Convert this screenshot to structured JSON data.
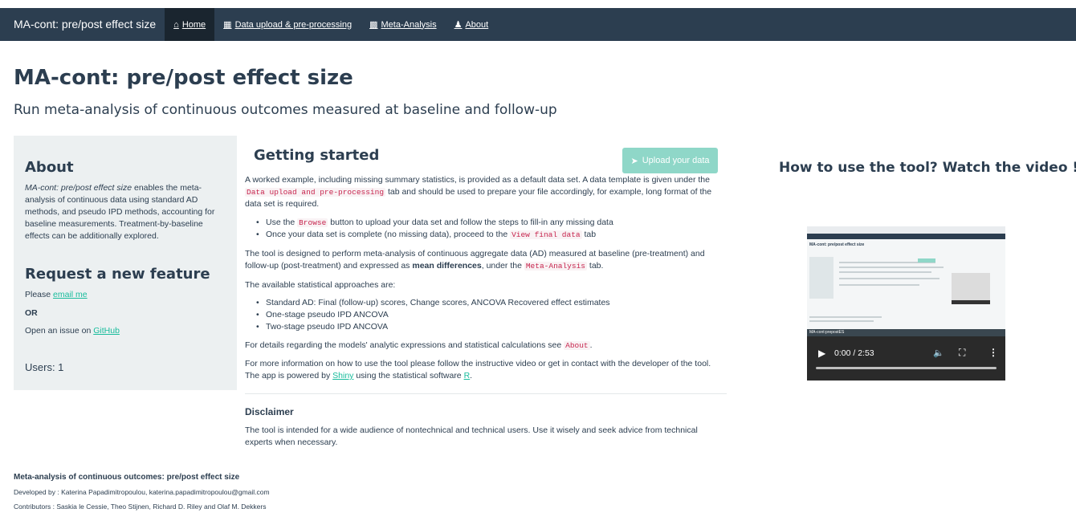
{
  "navbar": {
    "brand": "MA-cont: pre/post effect size",
    "items": [
      {
        "label": "Home",
        "icon": "home-icon",
        "active": true
      },
      {
        "label": "Data upload & pre-processing",
        "icon": "table-icon",
        "active": false
      },
      {
        "label": "Meta-Analysis",
        "icon": "bar-chart-icon",
        "active": false
      },
      {
        "label": "About",
        "icon": "users-icon",
        "active": false
      }
    ]
  },
  "header": {
    "title": "MA-cont: pre/post effect size",
    "subtitle": "Run meta-analysis of continuous outcomes measured at baseline and follow-up"
  },
  "sidebar": {
    "about_heading": "About",
    "about_italic": "MA-cont: pre/post effect size",
    "about_text": " enables the meta-analysis of continuous data using standard AD methods, and pseudo IPD methods, accounting for baseline measurements. Treatment-by-baseline effects can be additionally explored.",
    "request_heading": "Request a new feature",
    "please_text": "Please ",
    "email_link": "email me",
    "or_text": "OR",
    "issue_text": "Open an issue on ",
    "github_link": "GitHub",
    "users": "Users: 1"
  },
  "main": {
    "title": "Getting started",
    "upload_button": "Upload your data",
    "p1_a": "A worked example, including missing summary statistics, is provided as a default data set. A data template is given under the ",
    "p1_code": "Data upload and pre-processing",
    "p1_b": " tab and should be used to prepare your file accordingly, for example, long format of the data set is required.",
    "li1_a": "Use the ",
    "li1_code": "Browse",
    "li1_b": " button to upload your data set and follow the steps to fill-in any missing data",
    "li2_a": "Once your data set is complete (no missing data), proceed to the ",
    "li2_code": "View final data",
    "li2_b": " tab",
    "p2_a": "The tool is designed to perform meta-analysis of continuous aggregate data (AD) measured at baseline (pre-treatment) and follow-up (post-treatment) and expressed as ",
    "p2_bold": "mean differences",
    "p2_b": ", under the ",
    "p2_code": "Meta-Analysis",
    "p2_c": " tab.",
    "p3": "The available statistical approaches are:",
    "approaches": [
      "Standard AD: Final (follow-up) scores, Change scores, ANCOVA Recovered effect estimates",
      "One-stage pseudo IPD ANCOVA",
      "Two-stage pseudo IPD ANCOVA"
    ],
    "p4_a": "For details regarding the models' analytic expressions and statistical calculations see ",
    "p4_code": "About",
    "p4_b": ".",
    "p5_a": "For more information on how to use the tool please follow the instructive video or get in contact with the developer of the tool. The app is powered by ",
    "p5_shiny": "Shiny",
    "p5_b": " using the statistical software ",
    "p5_r": "R",
    "p5_c": ".",
    "disclaimer_heading": "Disclaimer",
    "disclaimer_text": "The tool is intended for a wide audience of nontechnical and technical users. Use it wisely and seek advice from technical experts when necessary."
  },
  "video": {
    "heading": "How to use the tool? Watch the video !",
    "time": "0:00 / 2:53",
    "thumb_title": "MA-cont: pre/post effect size",
    "thumb_bar_title": "MA-cont:prepostES"
  },
  "footer": {
    "title": "Meta-analysis of continuous outcomes: pre/post effect size",
    "developed": "Developed by : Katerina Papadimitropoulou, katerina.papadimitropoulou@gmail.com",
    "contributors": "Contributors : Saskia le Cessie, Theo Stijnen, Richard D. Riley and Olaf M. Dekkers"
  },
  "colors": {
    "navbar": "#2c3e50",
    "navbar_active": "#1a252f",
    "accent": "#18bc9c",
    "code": "#c7254e",
    "sidebar_bg": "#ecf0f1"
  }
}
